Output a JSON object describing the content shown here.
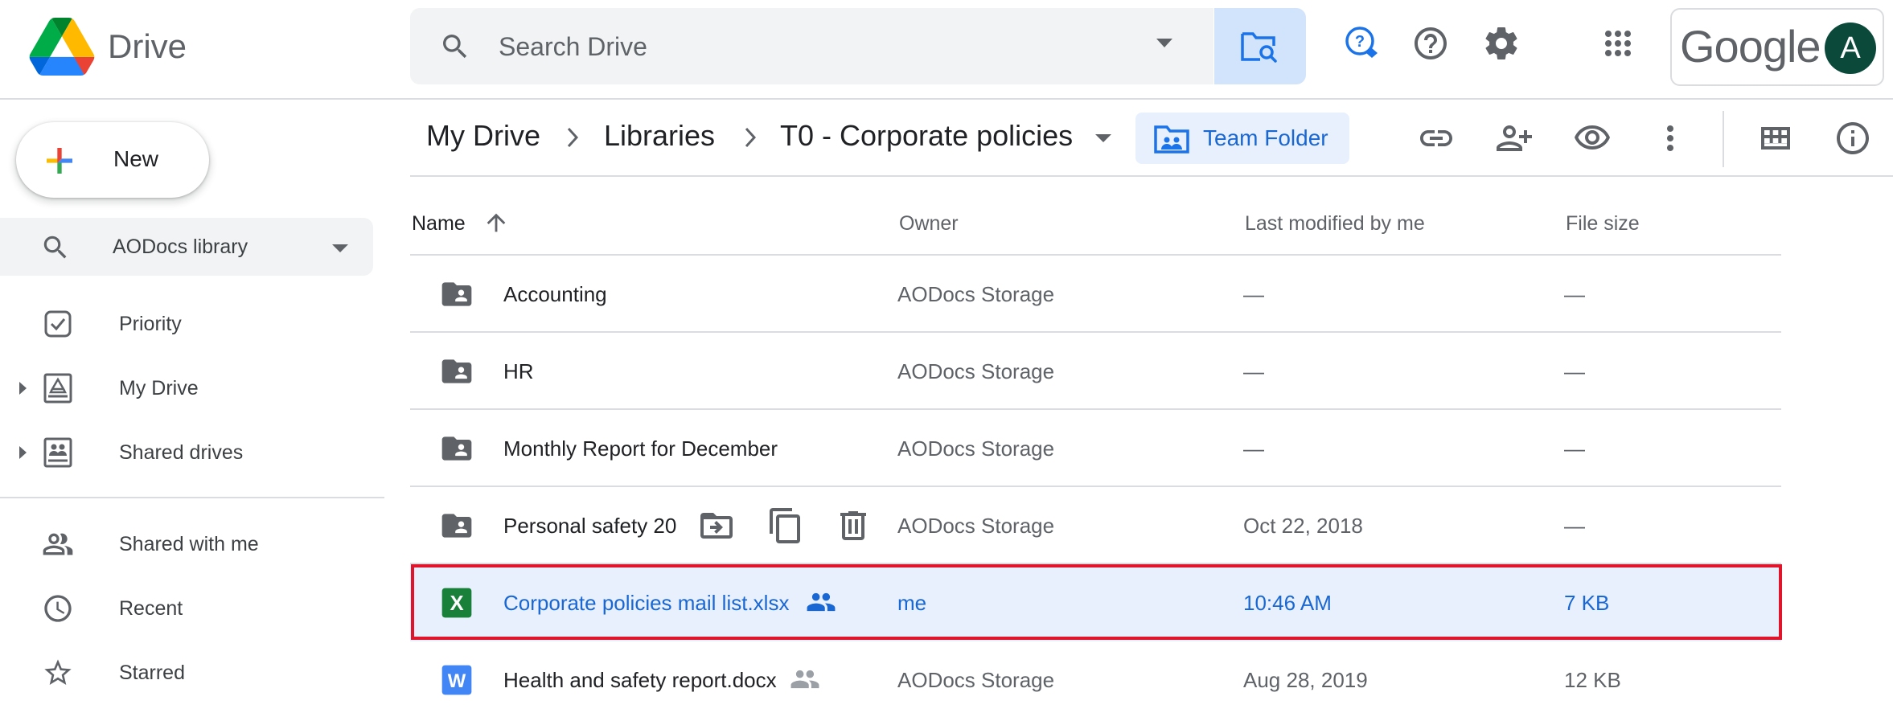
{
  "app": {
    "name": "Drive"
  },
  "search": {
    "placeholder": "Search Drive"
  },
  "account": {
    "brand": "Google",
    "avatar_letter": "A",
    "avatar_color": "#0b4a3b"
  },
  "sidebar": {
    "new_label": "New",
    "library_label": "AODocs library",
    "items": [
      {
        "label": "Priority",
        "icon": "priority-icon"
      },
      {
        "label": "My Drive",
        "icon": "my-drive-icon"
      },
      {
        "label": "Shared drives",
        "icon": "shared-drives-icon"
      },
      {
        "label": "Shared with me",
        "icon": "shared-with-me-icon"
      },
      {
        "label": "Recent",
        "icon": "clock-icon"
      },
      {
        "label": "Starred",
        "icon": "star-icon"
      }
    ]
  },
  "breadcrumb": {
    "items": [
      "My Drive",
      "Libraries",
      "T0 - Corporate policies"
    ],
    "team_folder_label": "Team Folder"
  },
  "file_list": {
    "columns": {
      "name": "Name",
      "owner": "Owner",
      "modified": "Last modified by me",
      "size": "File size"
    },
    "rows": [
      {
        "name": "Accounting",
        "type": "shared-folder",
        "owner": "AODocs Storage",
        "modified": "—",
        "size": "—"
      },
      {
        "name": "HR",
        "type": "shared-folder",
        "owner": "AODocs Storage",
        "modified": "—",
        "size": "—"
      },
      {
        "name": "Monthly Report for December",
        "type": "shared-folder",
        "owner": "AODocs Storage",
        "modified": "—",
        "size": "—"
      },
      {
        "name": "Personal safety 20",
        "type": "shared-folder",
        "owner": "AODocs Storage",
        "modified": "Oct 22, 2018",
        "size": "—"
      },
      {
        "name": "Corporate policies mail list.xlsx",
        "type": "sheet",
        "owner": "me",
        "modified": "10:46 AM",
        "size": "7 KB",
        "selected": true
      },
      {
        "name": "Health and safety report.docx",
        "type": "doc",
        "owner": "AODocs Storage",
        "modified": "Aug 28, 2019",
        "size": "12 KB"
      }
    ]
  },
  "colors": {
    "accent": "#1a73e8",
    "selected_row_bg": "#e8f0fe",
    "highlight_outline": "#e0142a",
    "sheet_green": "#188038",
    "doc_blue": "#4285f4"
  }
}
